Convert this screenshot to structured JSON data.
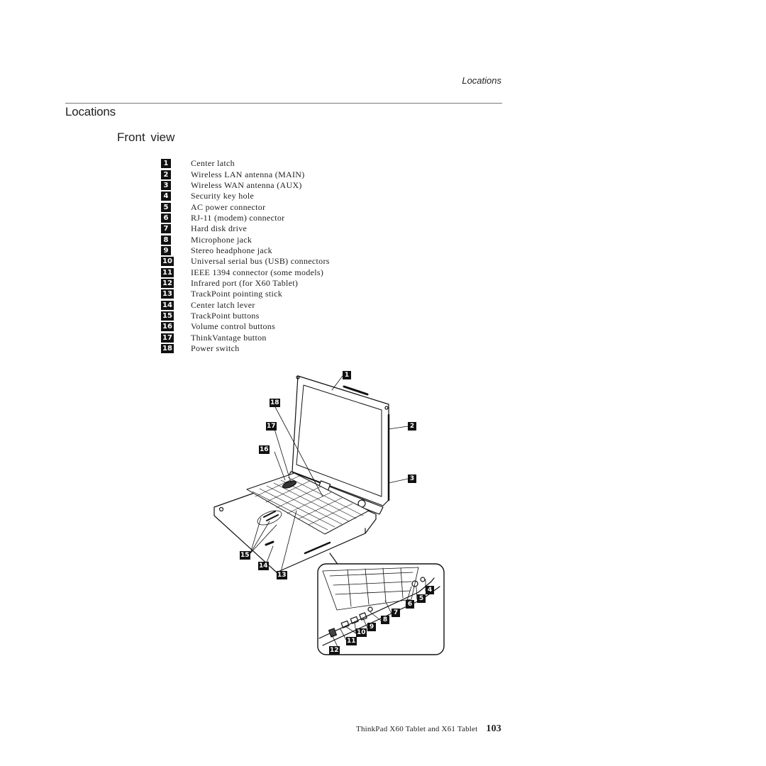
{
  "header": {
    "running_head": "Locations"
  },
  "section": {
    "title": "Locations",
    "subtitle": "Front view"
  },
  "legend": [
    {
      "number": "1",
      "label": "Center latch"
    },
    {
      "number": "2",
      "label": "Wireless LAN antenna (MAIN)"
    },
    {
      "number": "3",
      "label": "Wireless WAN antenna (AUX)"
    },
    {
      "number": "4",
      "label": "Security key hole"
    },
    {
      "number": "5",
      "label": "AC power connector"
    },
    {
      "number": "6",
      "label": "RJ-11 (modem) connector"
    },
    {
      "number": "7",
      "label": "Hard disk drive"
    },
    {
      "number": "8",
      "label": "Microphone jack"
    },
    {
      "number": "9",
      "label": "Stereo headphone jack"
    },
    {
      "number": "10",
      "label": "Universal serial bus (USB) connectors"
    },
    {
      "number": "11",
      "label": "IEEE 1394 connector (some models)"
    },
    {
      "number": "12",
      "label": "Infrared port (for X60 Tablet)"
    },
    {
      "number": "13",
      "label": "TrackPoint pointing stick"
    },
    {
      "number": "14",
      "label": "Center latch lever"
    },
    {
      "number": "15",
      "label": "TrackPoint buttons"
    },
    {
      "number": "16",
      "label": "Volume control buttons"
    },
    {
      "number": "17",
      "label": "ThinkVantage button"
    },
    {
      "number": "18",
      "label": "Power switch"
    }
  ],
  "figure": {
    "description": "ThinkPad X60 Tablet front view illustration with detail inset of front-left side ports",
    "callouts": [
      "1",
      "2",
      "3",
      "4",
      "5",
      "6",
      "7",
      "8",
      "9",
      "10",
      "11",
      "12",
      "13",
      "14",
      "15",
      "16",
      "17",
      "18"
    ]
  },
  "footer": {
    "book_title": "ThinkPad X60 Tablet and X61 Tablet",
    "page_number": "103"
  }
}
